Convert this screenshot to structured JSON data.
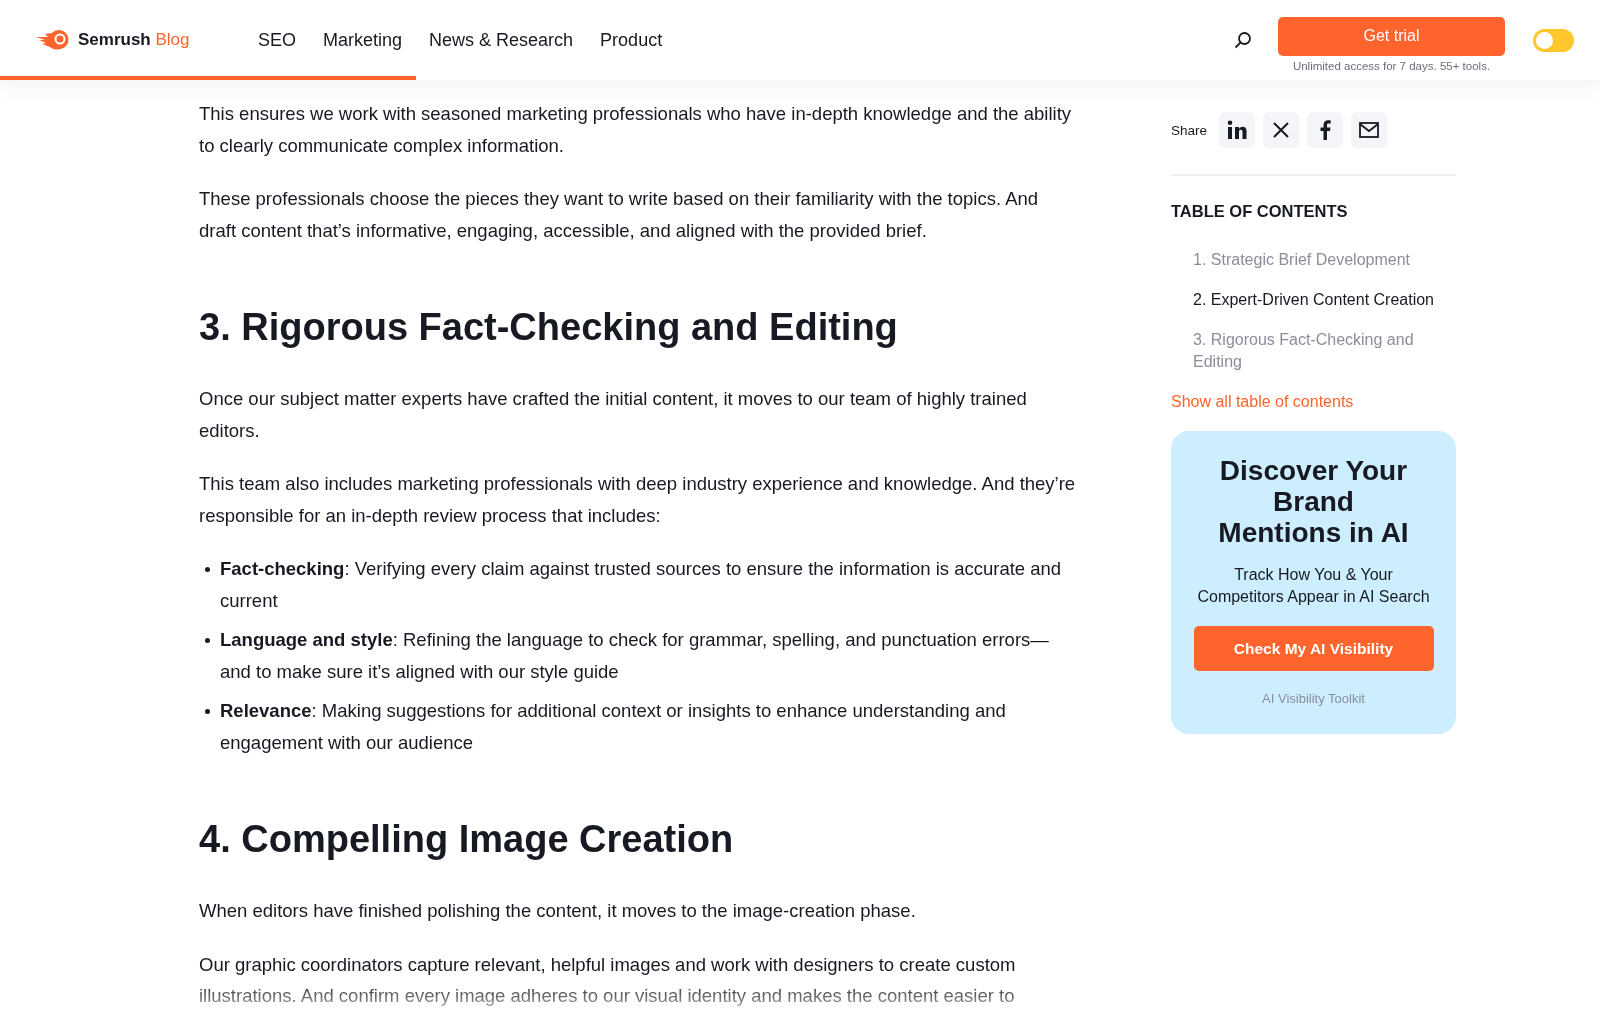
{
  "header": {
    "logo": {
      "brand": "Semrush",
      "product": "Blog"
    },
    "nav": [
      {
        "label": "SEO"
      },
      {
        "label": "Marketing"
      },
      {
        "label": "News & Research"
      },
      {
        "label": "Product"
      }
    ],
    "trial_button": "Get trial",
    "trial_note": "Unlimited access for 7 days. 55+ tools.",
    "theme_toggle": {
      "on": false
    },
    "reading_progress": {
      "level": 0.26
    }
  },
  "article": [
    {
      "kind": "paragraph",
      "text": "This ensures we work with seasoned marketing professionals who have in-depth knowledge and the ability to clearly communicate complex information."
    },
    {
      "kind": "paragraph",
      "text": "These professionals choose the pieces they want to write based on their familiarity with the topics. And draft content that’s informative, engaging, accessible, and aligned with the provided brief."
    },
    {
      "kind": "heading",
      "text": "3. Rigorous Fact-Checking and Editing"
    },
    {
      "kind": "paragraph",
      "text": "Once our subject matter experts have crafted the initial content, it moves to our team of highly trained editors."
    },
    {
      "kind": "paragraph",
      "text": "This team also includes marketing professionals with deep industry experience and knowledge. And they’re responsible for an in-depth review process that includes:"
    },
    {
      "kind": "list",
      "items": [
        "**Fact-checking**: Verifying every claim against trusted sources to ensure the information is accurate and current",
        "**Language and style**: Refining the language to check for grammar, spelling, and punctuation errors—and to make sure it’s aligned with our style guide",
        "**Relevance**: Making suggestions for additional context or insights to enhance understanding and engagement with our audience"
      ]
    },
    {
      "kind": "heading",
      "text": "4. Compelling Image Creation"
    },
    {
      "kind": "paragraph",
      "text": "When editors have finished polishing the content, it moves to the image-creation phase."
    },
    {
      "kind": "faded",
      "text": "Our graphic coordinators capture relevant, helpful images and work with designers to create custom illustrations. And confirm every image adheres to our visual identity and makes the content easier to"
    }
  ],
  "sidebar": {
    "share_label": "Share",
    "toc_title": "TABLE OF CONTENTS",
    "toc": [
      {
        "label": "1. Strategic Brief Development",
        "selected": false
      },
      {
        "label": "2. Expert-Driven Content Creation",
        "selected": true
      },
      {
        "label": "3. Rigorous Fact-Checking and Editing",
        "selected": false
      }
    ],
    "toc_link": "Show all table of contents",
    "promo": {
      "title": "Discover Your Brand Mentions in AI",
      "subtitle": "Track How You & Your Competitors Appear in AI Search",
      "button": "Check My AI Visibility",
      "footnote": "AI Visibility Toolkit"
    }
  }
}
